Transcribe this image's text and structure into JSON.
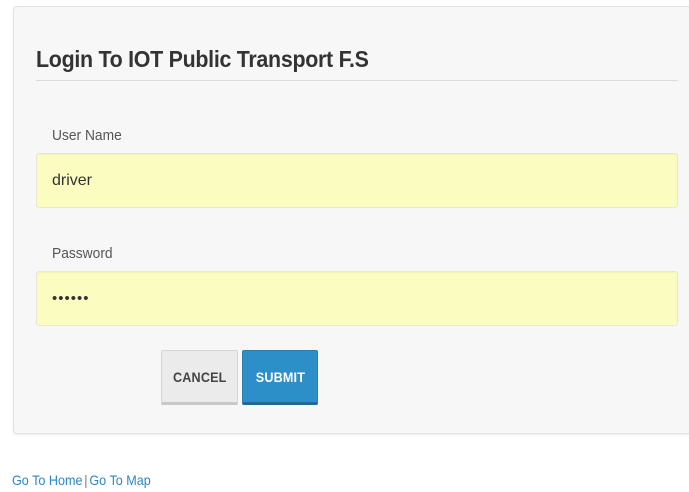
{
  "login": {
    "title": "Login To IOT Public Transport F.S",
    "username_label": "User Name",
    "username_value": "driver",
    "password_label": "Password",
    "password_value": "••••••",
    "cancel_label": "CANCEL",
    "submit_label": "SUBMIT"
  },
  "footer": {
    "home_link": "Go To Home",
    "separator": "|",
    "map_link": "Go To Map"
  },
  "colors": {
    "input_fill": "#fbfcc0",
    "submit_button": "#2d8fc7",
    "link": "#2a88c5"
  }
}
